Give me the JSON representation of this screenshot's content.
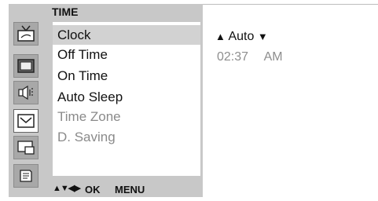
{
  "panel": {
    "title": "TIME",
    "menu_items": [
      {
        "label": "Clock",
        "state": "selected"
      },
      {
        "label": "Off Time",
        "state": "normal"
      },
      {
        "label": "On Time",
        "state": "normal"
      },
      {
        "label": "Auto Sleep",
        "state": "normal"
      },
      {
        "label": "Time Zone",
        "state": "disabled"
      },
      {
        "label": "D. Saving",
        "state": "disabled"
      }
    ],
    "icons": [
      "tv-picture-icon",
      "screen-icon",
      "speaker-icon",
      "clock-icon",
      "pip-icon",
      "option-icon"
    ],
    "active_icon_index": 3
  },
  "bottom_bar": {
    "nav_arrows": "▲▼◀▶",
    "ok_label": "OK",
    "menu_label": "MENU"
  },
  "clock_settings": {
    "mode_left_arrow": "▲",
    "mode_value": "Auto",
    "mode_right_arrow": "▼",
    "time": "02:37",
    "ampm": "AM"
  },
  "colors": {
    "panel_bg": "#c8c8c8",
    "selected_bg": "#d2d2d2",
    "disabled_text": "#8a8a8a"
  }
}
